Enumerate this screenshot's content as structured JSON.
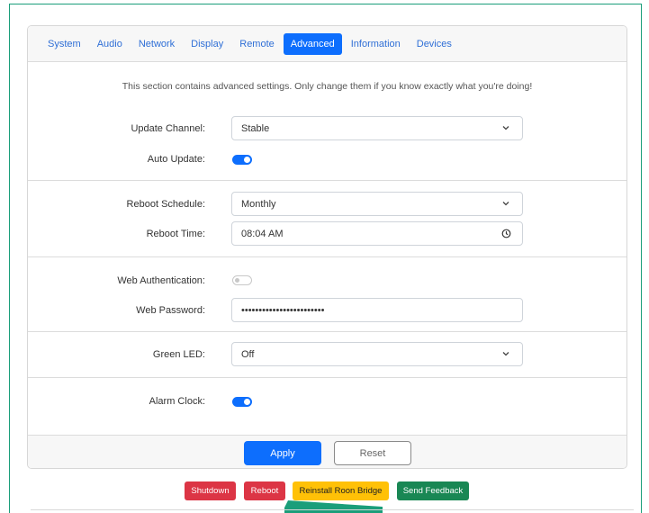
{
  "tabs": [
    {
      "label": "System"
    },
    {
      "label": "Audio"
    },
    {
      "label": "Network"
    },
    {
      "label": "Display"
    },
    {
      "label": "Remote"
    },
    {
      "label": "Advanced"
    },
    {
      "label": "Information"
    },
    {
      "label": "Devices"
    }
  ],
  "active_tab": "Advanced",
  "intro_text": "This section contains advanced settings. Only change them if you know exactly what you're doing!",
  "update": {
    "channel_label": "Update Channel:",
    "channel_value": "Stable",
    "auto_update_label": "Auto Update:",
    "auto_update": true
  },
  "reboot": {
    "schedule_label": "Reboot Schedule:",
    "schedule_value": "Monthly",
    "time_label": "Reboot Time:",
    "time_value": "08:04 AM"
  },
  "web": {
    "auth_label": "Web Authentication:",
    "auth_enabled": false,
    "password_label": "Web Password:",
    "password_value": "••••••••••••••••••••••••"
  },
  "led": {
    "label": "Green LED:",
    "value": "Off"
  },
  "alarm": {
    "label": "Alarm Clock:",
    "enabled": true
  },
  "footer": {
    "apply_label": "Apply",
    "reset_label": "Reset"
  },
  "actions": {
    "shutdown_label": "Shutdown",
    "reboot_label": "Reboot",
    "reinstall_label": "Reinstall Roon Bridge",
    "feedback_label": "Send Feedback"
  },
  "colors": {
    "primary": "#0d6efd",
    "danger": "#dc3545",
    "warning": "#ffc107",
    "success": "#198754",
    "frame_border": "#1a9e7a",
    "arrow": "#1a9e7a"
  }
}
